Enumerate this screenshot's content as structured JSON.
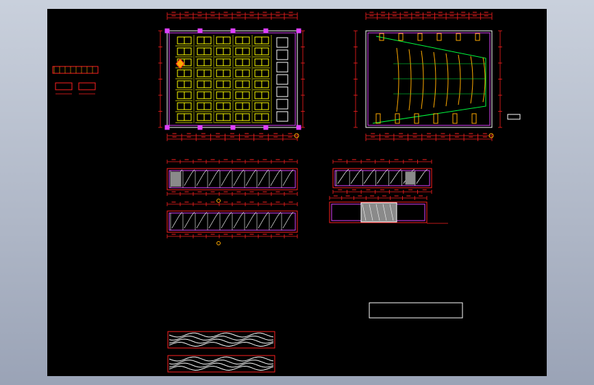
{
  "viewport": {
    "background": "#000000"
  },
  "colors": {
    "outline": "#ff2020",
    "wall": "#e040ff",
    "seat": "#ffff00",
    "green": "#00ff40",
    "white": "#ffffff",
    "grey": "#8a8a8a",
    "orange": "#ffaa00"
  },
  "drawings": [
    {
      "id": "floor-plan-seating",
      "kind": "plan"
    },
    {
      "id": "ceiling-plan",
      "kind": "plan"
    },
    {
      "id": "elevation-a",
      "kind": "elevation"
    },
    {
      "id": "elevation-b",
      "kind": "elevation"
    },
    {
      "id": "elevation-c",
      "kind": "elevation"
    },
    {
      "id": "elevation-d",
      "kind": "elevation"
    },
    {
      "id": "wave-panel-1",
      "kind": "detail"
    },
    {
      "id": "wave-panel-2",
      "kind": "detail"
    },
    {
      "id": "legend-detail",
      "kind": "detail"
    },
    {
      "id": "empty-title-frame",
      "kind": "frame"
    }
  ]
}
